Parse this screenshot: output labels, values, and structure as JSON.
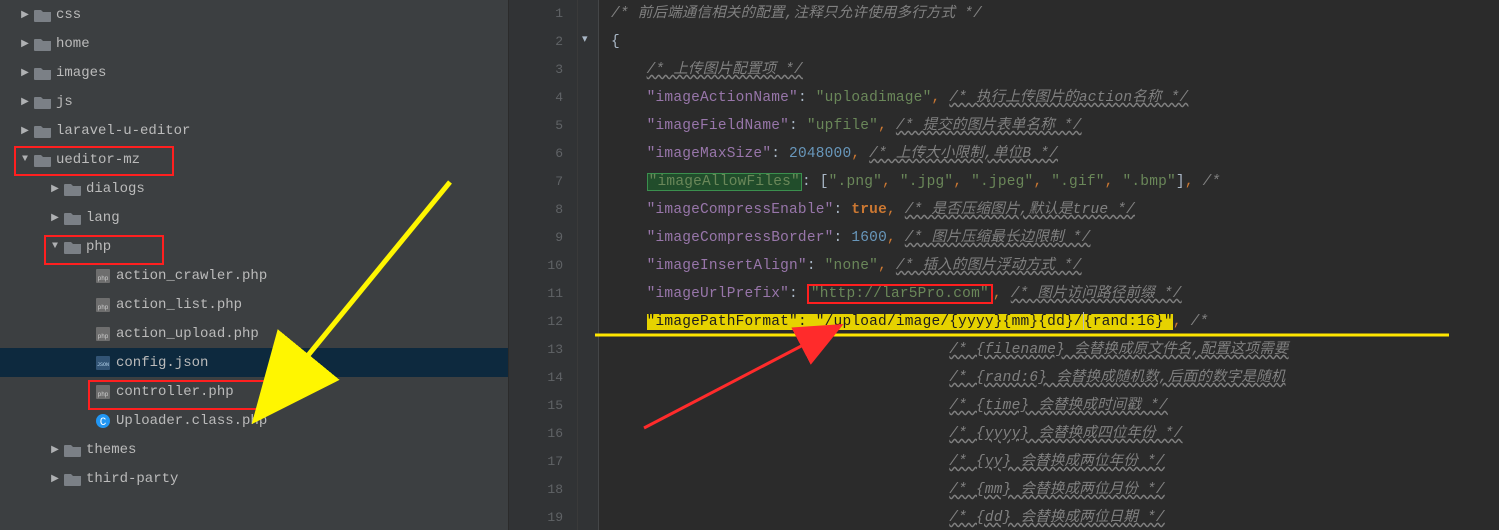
{
  "tree": {
    "nodes": [
      {
        "kind": "folder",
        "arrow": "right",
        "indent": 1,
        "label": "css",
        "hl": false
      },
      {
        "kind": "folder",
        "arrow": "right",
        "indent": 1,
        "label": "home",
        "hl": false
      },
      {
        "kind": "folder",
        "arrow": "right",
        "indent": 1,
        "label": "images",
        "hl": false
      },
      {
        "kind": "folder",
        "arrow": "right",
        "indent": 1,
        "label": "js",
        "hl": false
      },
      {
        "kind": "folder",
        "arrow": "right",
        "indent": 1,
        "label": "laravel-u-editor",
        "hl": false
      },
      {
        "kind": "folder",
        "arrow": "down",
        "indent": 1,
        "label": "ueditor-mz",
        "hl": true
      },
      {
        "kind": "folder",
        "arrow": "right",
        "indent": 2,
        "label": "dialogs",
        "hl": false
      },
      {
        "kind": "folder",
        "arrow": "right",
        "indent": 2,
        "label": "lang",
        "hl": false
      },
      {
        "kind": "folder",
        "arrow": "down",
        "indent": 2,
        "label": "php",
        "hl": true
      },
      {
        "kind": "php",
        "arrow": "",
        "indent": 3,
        "label": "action_crawler.php",
        "hl": false
      },
      {
        "kind": "php",
        "arrow": "",
        "indent": 3,
        "label": "action_list.php",
        "hl": false
      },
      {
        "kind": "php",
        "arrow": "",
        "indent": 3,
        "label": "action_upload.php",
        "hl": false
      },
      {
        "kind": "json",
        "arrow": "",
        "indent": 3,
        "label": "config.json",
        "hl": true,
        "selected": true
      },
      {
        "kind": "php",
        "arrow": "",
        "indent": 3,
        "label": "controller.php",
        "hl": false
      },
      {
        "kind": "class",
        "arrow": "",
        "indent": 3,
        "label": "Uploader.class.php",
        "hl": false
      },
      {
        "kind": "folder",
        "arrow": "right",
        "indent": 2,
        "label": "themes",
        "hl": false
      },
      {
        "kind": "folder",
        "arrow": "right",
        "indent": 2,
        "label": "third-party",
        "hl": false
      }
    ]
  },
  "gutter": [
    "1",
    "2",
    "3",
    "4",
    "5",
    "6",
    "7",
    "8",
    "9",
    "10",
    "11",
    "12",
    "13",
    "14",
    "15",
    "16",
    "17",
    "18",
    "19"
  ],
  "code": {
    "l1": {
      "comment": "/* 前后端通信相关的配置,注释只允许使用多行方式 */"
    },
    "l2": {
      "brace": "{"
    },
    "l3": {
      "comment": "/* 上传图片配置项 */"
    },
    "l4": {
      "key": "\"imageActionName\"",
      "val": "\"uploadimage\"",
      "comment": "/* 执行上传图片的action名称 */"
    },
    "l5": {
      "key": "\"imageFieldName\"",
      "val": "\"upfile\"",
      "comment": "/* 提交的图片表单名称 */"
    },
    "l6": {
      "key": "\"imageMaxSize\"",
      "num": "2048000",
      "comment": "/* 上传大小限制,单位B */"
    },
    "l7": {
      "keyhl": "\"imageAllowFiles\"",
      "arr": [
        "\".png\"",
        "\".jpg\"",
        "\".jpeg\"",
        "\".gif\"",
        "\".bmp\""
      ],
      "tail": "/*"
    },
    "l8": {
      "key": "\"imageCompressEnable\"",
      "bool": "true",
      "comment": "/* 是否压缩图片,默认是true */"
    },
    "l9": {
      "key": "\"imageCompressBorder\"",
      "num": "1600",
      "comment": "/* 图片压缩最长边限制 */"
    },
    "l10": {
      "key": "\"imageInsertAlign\"",
      "val": "\"none\"",
      "comment": "/* 插入的图片浮动方式 */"
    },
    "l11": {
      "key": "\"imageUrlPrefix\"",
      "valred": "\"http://lar5Pro.com\"",
      "comment": "/* 图片访问路径前缀 */"
    },
    "l12": {
      "keyhl2": "\"imagePathFormat\"",
      "pathA": "\"/upload/image/{yyyy}{mm}{dd}/",
      "pathB": "{rand:16}\"",
      "tail": "/*"
    },
    "l13": {
      "comment": "/* {filename} 会替换成原文件名,配置这项需要"
    },
    "l14": {
      "comment": "/* {rand:6} 会替换成随机数,后面的数字是随机"
    },
    "l15": {
      "comment": "/* {time} 会替换成时间戳 */"
    },
    "l16": {
      "comment": "/* {yyyy} 会替换成四位年份 */"
    },
    "l17": {
      "comment": "/* {yy} 会替换成两位年份 */"
    },
    "l18": {
      "comment": "/* {mm} 会替换成两位月份 */"
    },
    "l19": {
      "comment": "/* {dd} 会替换成两位日期 */"
    }
  }
}
